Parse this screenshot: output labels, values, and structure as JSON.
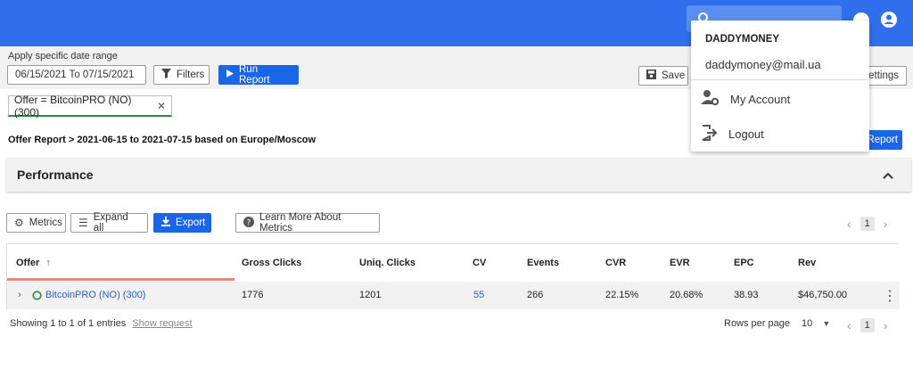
{
  "header": {
    "search_icon": "search-icon",
    "help_icon": "help-icon",
    "user_icon": "account-circle-icon"
  },
  "toolbar": {
    "date_label": "Apply specific date range",
    "date_range": "06/15/2021 To 07/15/2021",
    "filters_label": "Filters",
    "run_label": "Run Report",
    "save_label": "Save",
    "settings_label": "ettings"
  },
  "filter_chip": {
    "label": "Offer = BitcoinPRO (NO) (300)",
    "close": "✕"
  },
  "report": {
    "heading": "Offer Report > 2021-06-15 to 2021-07-15 based on Europe/Moscow",
    "report_btn": "Report"
  },
  "performance": {
    "title": "Performance"
  },
  "actions": {
    "metrics": "Metrics",
    "expand_all": "Expand all",
    "export": "Export",
    "learn_more": "Learn More About Metrics"
  },
  "pager_top": {
    "page": "1"
  },
  "table": {
    "columns": [
      "Offer",
      "Gross Clicks",
      "Uniq. Clicks",
      "CV",
      "Events",
      "CVR",
      "EVR",
      "EPC",
      "Rev"
    ],
    "sort_icon": "↑",
    "row": {
      "offer": "BitcoinPRO (NO) (300)",
      "gross_clicks": "1776",
      "uniq_clicks": "1201",
      "cv": "55",
      "events": "266",
      "cvr": "22.15%",
      "evr": "20.68%",
      "epc": "38.93",
      "rev": "$46,750.00"
    }
  },
  "footer": {
    "showing": "Showing 1 to 1 of 1 entries",
    "show_request": "Show request",
    "rows_per_page_label": "Rows per page",
    "rows_per_page_value": "10",
    "page": "1"
  },
  "account_menu": {
    "username": "DADDYMONEY",
    "email": "daddymoney@mail.ua",
    "my_account": "My Account",
    "logout": "Logout"
  },
  "colors": {
    "brand": "#2f6fee",
    "primary_button": "#1a66e8",
    "link": "#2a5fbf",
    "chip_underline": "#2e8b3a",
    "status_dot": "#2e8b3a"
  }
}
